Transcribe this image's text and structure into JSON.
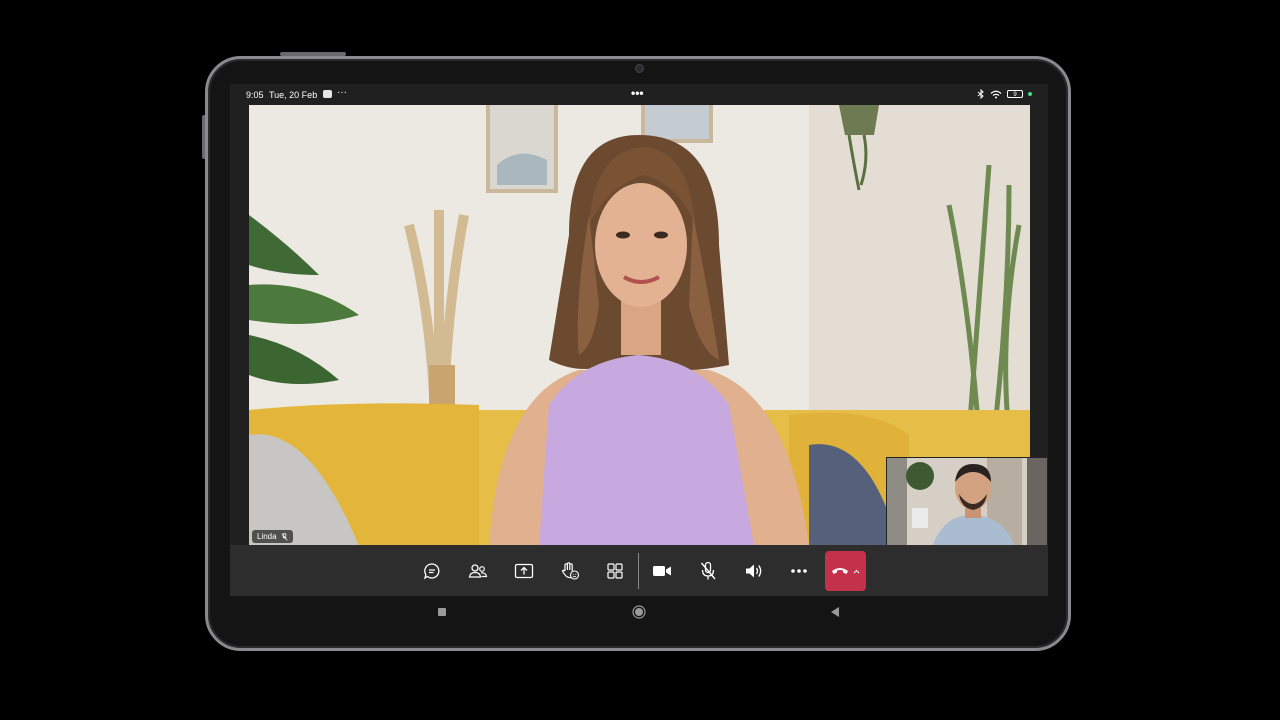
{
  "status_bar": {
    "time": "9:05",
    "date": "Tue, 20 Feb",
    "battery": "9"
  },
  "call": {
    "participant_name": "Linda",
    "participant_muted": true
  },
  "toolbar": {
    "buttons": [
      "chat-icon",
      "people-icon",
      "share-screen-icon",
      "raise-hand-icon",
      "view-layout-icon",
      "video-camera-icon",
      "microphone-muted-icon",
      "speaker-icon",
      "more-options-icon"
    ],
    "end_call_color": "#c4314b"
  },
  "colors": {
    "toolbar_bg": "#2d2d2d",
    "end_call": "#c4314b"
  }
}
